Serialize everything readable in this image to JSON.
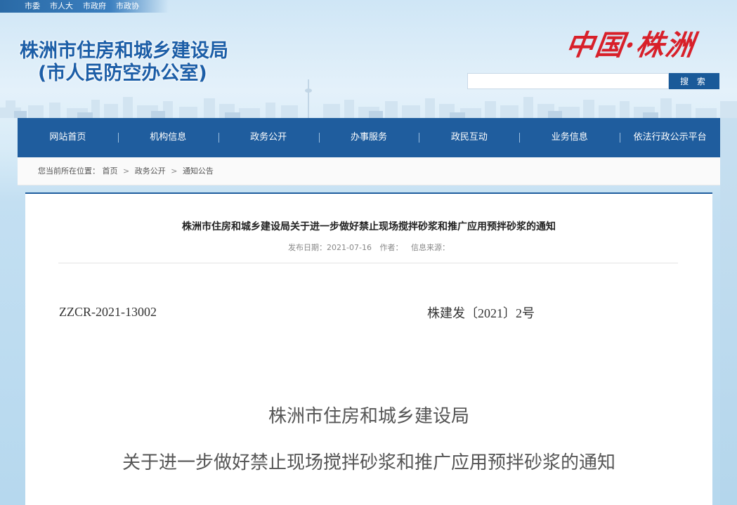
{
  "topbar": {
    "links": [
      "市委",
      "市人大",
      "市政府",
      "市政协"
    ]
  },
  "header": {
    "title_line1": "株洲市住房和城乡建设局",
    "title_line2": "(市人民防空办公室)",
    "logo_text": "中国·株洲"
  },
  "search": {
    "value": "",
    "button_label": "搜 索"
  },
  "nav": {
    "items": [
      "网站首页",
      "机构信息",
      "政务公开",
      "办事服务",
      "政民互动",
      "业务信息",
      "依法行政公示平台"
    ]
  },
  "breadcrumb": {
    "prefix": "您当前所在位置：",
    "items": [
      "首页",
      "政务公开",
      "通知公告"
    ],
    "separator": ">"
  },
  "article": {
    "title": "株洲市住房和城乡建设局关于进一步做好禁止现场搅拌砂浆和推广应用预拌砂浆的通知",
    "publish_date_label": "发布日期：2021-07-16",
    "author_label": "作者：",
    "source_label": "信息来源：",
    "doc_code": "ZZCR-2021-13002",
    "doc_number": "株建发〔2021〕2号",
    "heading_line1": "株洲市住房和城乡建设局",
    "heading_line2": "关于进一步做好禁止现场搅拌砂浆和推广应用预拌砂浆的通知"
  },
  "colors": {
    "brand_blue": "#1f5d9e",
    "title_blue": "#1c5ea7",
    "logo_red": "#d8202a"
  }
}
